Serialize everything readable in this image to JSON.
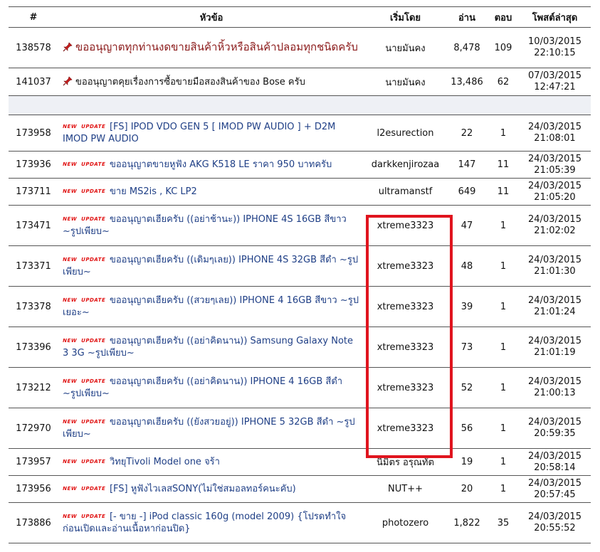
{
  "headers": {
    "id": "#",
    "title": "หัวข้อ",
    "author": "เริ่มโดย",
    "views": "อ่าน",
    "replies": "ตอบ",
    "last": "โพสต์ล่าสุด"
  },
  "badges": {
    "new": "NEW",
    "update": "UPDATE"
  },
  "colors": {
    "highlight": "#e0141e",
    "link": "#1f3f86",
    "sticky": "#8b1a1a"
  },
  "sticky": [
    {
      "id": "138578",
      "title": "ขออนุญาตทุกท่านงดขายสินค้าหิ้วหรือสินค้าปลอมทุกชนิดครับ",
      "author": "นายมันคง",
      "views": "8,478",
      "replies": "109",
      "date": "10/03/2015",
      "time": "22:10:15"
    },
    {
      "id": "141037",
      "title": "ขออนุญาตคุยเรื่องการซื้อขายมือสองสินค้าของ Bose ครับ",
      "author": "นายมันคง",
      "views": "13,486",
      "replies": "62",
      "date": "07/03/2015",
      "time": "12:47:21"
    }
  ],
  "topics": [
    {
      "id": "173958",
      "title": "[FS] IPOD VDO GEN 5 [ IMOD PW AUDIO ] + D2M IMOD PW AUDIO",
      "author": "l2esurection",
      "views": "22",
      "replies": "1",
      "date": "24/03/2015",
      "time": "21:08:01"
    },
    {
      "id": "173936",
      "title": "ขออนุญาตขายหูฟัง AKG K518 LE ราคา 950 บาทครับ",
      "author": "darkkenjirozaa",
      "views": "147",
      "replies": "11",
      "date": "24/03/2015",
      "time": "21:05:39"
    },
    {
      "id": "173711",
      "title": "ขาย MS2is , KC LP2",
      "author": "ultramanstf",
      "views": "649",
      "replies": "11",
      "date": "24/03/2015",
      "time": "21:05:20"
    },
    {
      "id": "173471",
      "title": "ขออนุญาตเฮียครับ ((อย่าช้านะ)) IPHONE 4S 16GB สีขาว ~รูปเพียบ~",
      "author": "xtreme3323",
      "views": "47",
      "replies": "1",
      "date": "24/03/2015",
      "time": "21:02:02"
    },
    {
      "id": "173371",
      "title": "ขออนุญาตเฮียครับ ((เดิมๆเลย)) IPHONE 4S 32GB สีดำ ~รูปเพียบ~",
      "author": "xtreme3323",
      "views": "48",
      "replies": "1",
      "date": "24/03/2015",
      "time": "21:01:30"
    },
    {
      "id": "173378",
      "title": "ขออนุญาตเฮียครับ ((สวยๆเลย)) IPHONE 4 16GB สีขาว ~รูปเยอะ~",
      "author": "xtreme3323",
      "views": "39",
      "replies": "1",
      "date": "24/03/2015",
      "time": "21:01:24"
    },
    {
      "id": "173396",
      "title": "ขออนุญาตเฮียครับ ((อย่าคิดนาน)) Samsung Galaxy Note 3 3G ~รูปเพียบ~",
      "author": "xtreme3323",
      "views": "73",
      "replies": "1",
      "date": "24/03/2015",
      "time": "21:01:19"
    },
    {
      "id": "173212",
      "title": "ขออนุญาตเฮียครับ ((อย่าคิดนาน)) IPHONE 4 16GB สีดำ ~รูปเพียบ~",
      "author": "xtreme3323",
      "views": "52",
      "replies": "1",
      "date": "24/03/2015",
      "time": "21:00:13"
    },
    {
      "id": "172970",
      "title": "ขออนุญาตเฮียครับ ((ยังสวยอยู่)) IPHONE 5 32GB สีดำ ~รูปเพียบ~",
      "author": "xtreme3323",
      "views": "56",
      "replies": "1",
      "date": "24/03/2015",
      "time": "20:59:35"
    },
    {
      "id": "173957",
      "title": "วิทยุTivoli Model one จร้า",
      "author": "นิมิตร อรุณทัต",
      "views": "19",
      "replies": "1",
      "date": "24/03/2015",
      "time": "20:58:14"
    },
    {
      "id": "173956",
      "title": "[FS] หูฟังไวเลสSONY(ไม่ใช่สมอลทอร์คนะคับ)",
      "author": "NUT++",
      "views": "20",
      "replies": "1",
      "date": "24/03/2015",
      "time": "20:57:45"
    },
    {
      "id": "173886",
      "title": "[- ขาย -] iPod classic 160g (model 2009) {โปรดทำใจก่อนเปิดและอ่านเนื้อหาก่อนปิด}",
      "author": "photozero",
      "views": "1,822",
      "replies": "35",
      "date": "24/03/2015",
      "time": "20:55:52"
    }
  ]
}
